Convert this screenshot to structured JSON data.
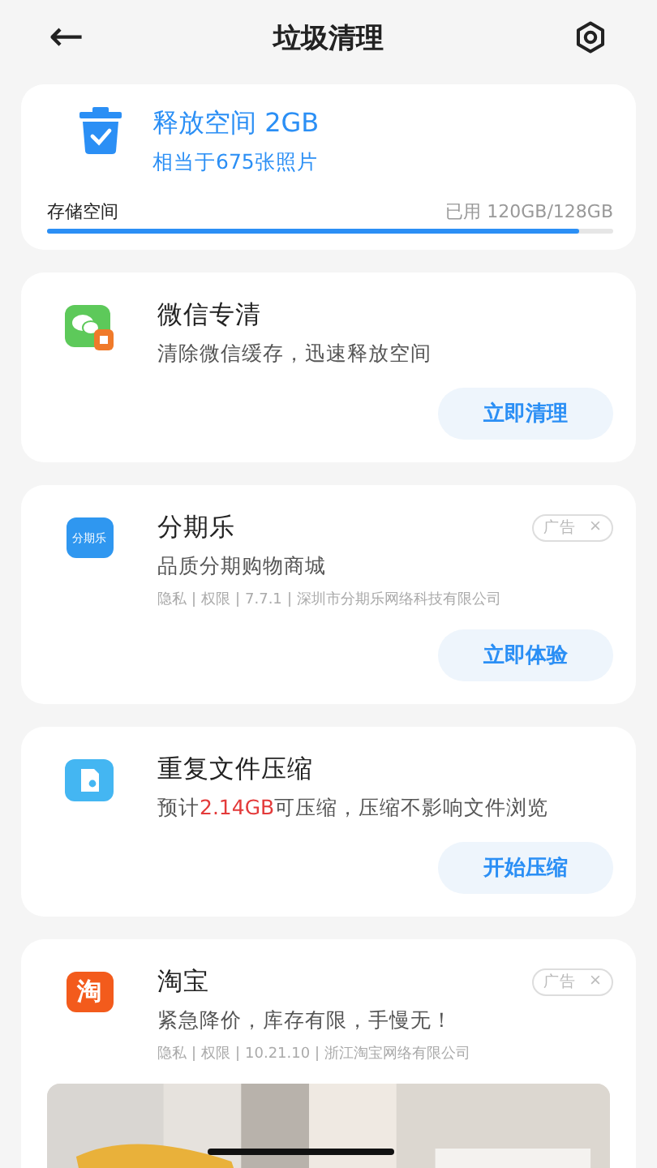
{
  "header": {
    "back": "←",
    "title": "垃圾清理"
  },
  "summary": {
    "title": "释放空间 2GB",
    "subtitle": "相当于675张照片",
    "storage_label": "存储空间",
    "storage_reading": "已用 120GB/128GB",
    "level": 0.94
  },
  "cards": [
    {
      "kind": "feature",
      "title": "微信专清",
      "desc_parts": [
        {
          "text": "清除微信缓存，迅速释放空间",
          "highlight": false
        }
      ],
      "button": "立即清理"
    },
    {
      "kind": "ad",
      "icon_text": "分期乐",
      "title": "分期乐",
      "ad_tag": "广告",
      "ad_close": "×",
      "subtitle": "品质分期购物商城",
      "meta": [
        "隐私",
        "权限",
        "7.7.1",
        "深圳市分期乐网络科技有限公司"
      ],
      "button": "立即体验"
    },
    {
      "kind": "feature",
      "title": "重复文件压缩",
      "desc_parts": [
        {
          "text": "预计",
          "highlight": false
        },
        {
          "text": "2.14GB",
          "highlight": true
        },
        {
          "text": "可压缩，压缩不影响文件浏览",
          "highlight": false
        }
      ],
      "button": "开始压缩"
    },
    {
      "kind": "ad",
      "icon_text": "淘",
      "title": "淘宝",
      "ad_tag": "广告",
      "ad_close": "×",
      "subtitle": "紧急降价，库存有限，手慢无！",
      "meta": [
        "隐私",
        "权限",
        "10.21.10",
        "浙江淘宝网络有限公司"
      ]
    }
  ]
}
